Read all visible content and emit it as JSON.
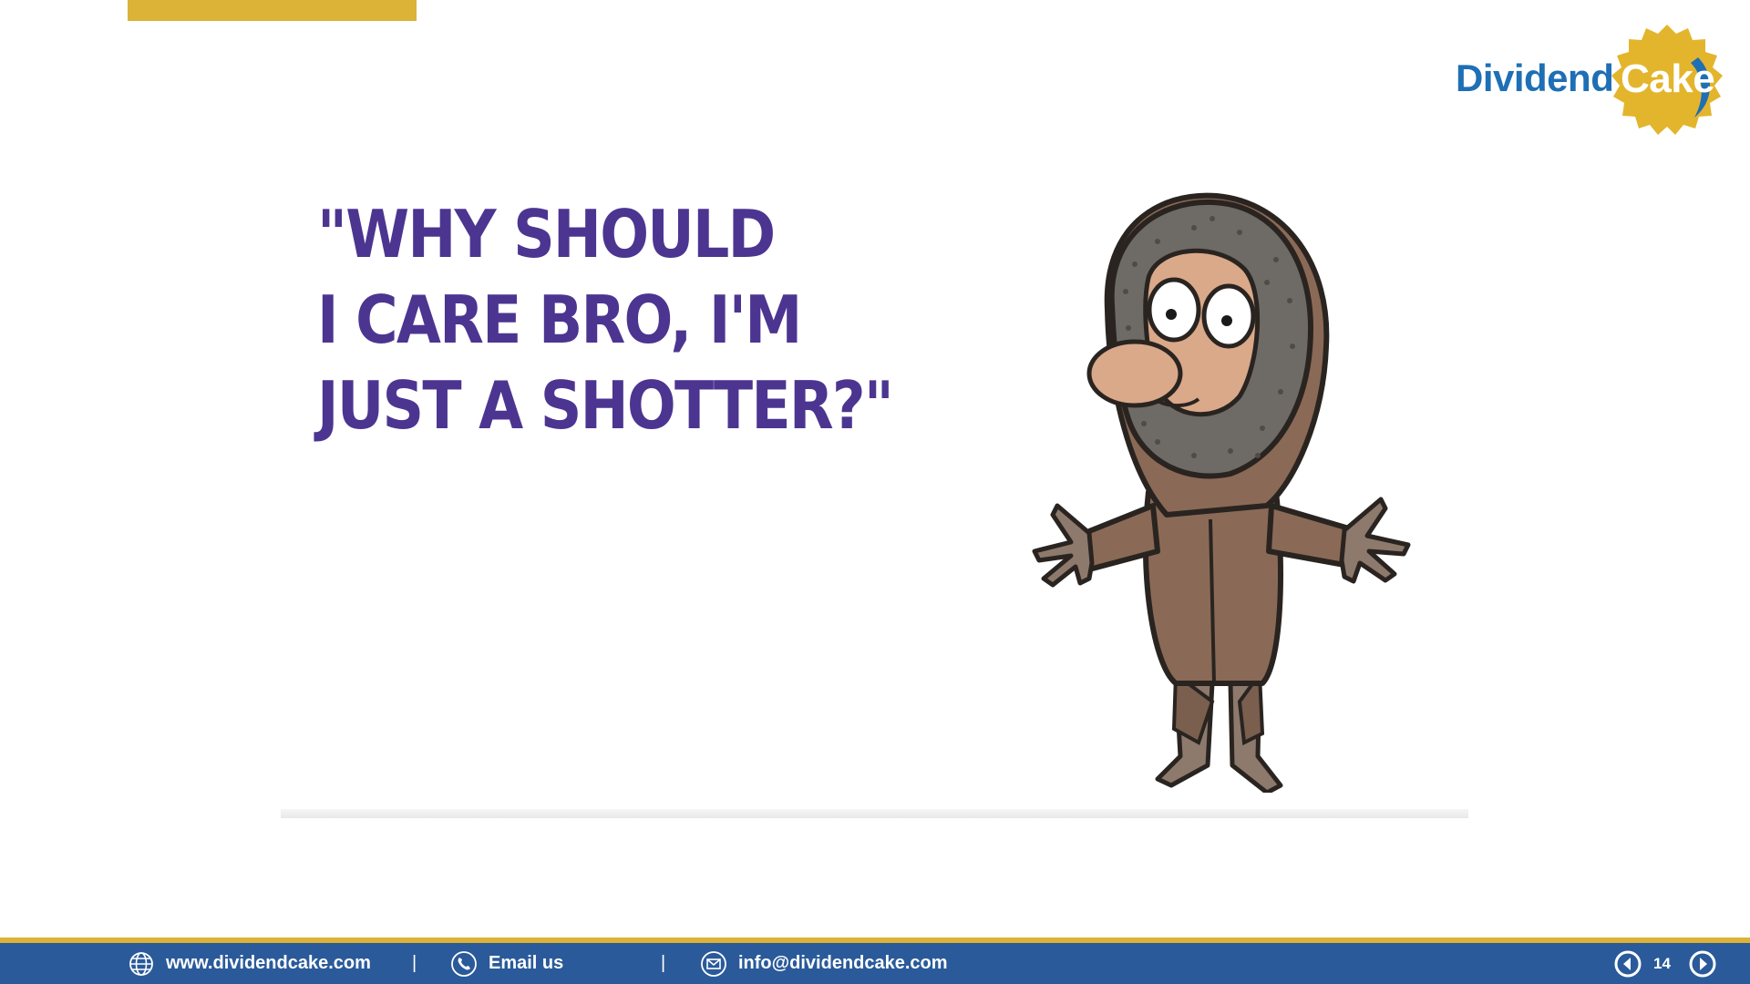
{
  "logo": {
    "word": "Dividend",
    "badge_word": "Cake",
    "brand_blue": "#1e6fb5",
    "brand_gold": "#dcb237"
  },
  "slide": {
    "quote_lines": [
      "\"WHY SHOULD",
      "I CARE BRO, I'M",
      "JUST A SHOTTER?\""
    ],
    "quote_color": "#4c3591",
    "illustration": "cartoon-hooded-character"
  },
  "footer": {
    "website": "www.dividendcake.com",
    "email_label": "Email us",
    "email_address": "info@dividendcake.com",
    "separator": "|",
    "page_number": "14",
    "icons": [
      "globe-icon",
      "phone-icon",
      "envelope-icon",
      "prev-arrow-icon",
      "next-arrow-icon"
    ],
    "bar_color": "#2a5a9a"
  }
}
